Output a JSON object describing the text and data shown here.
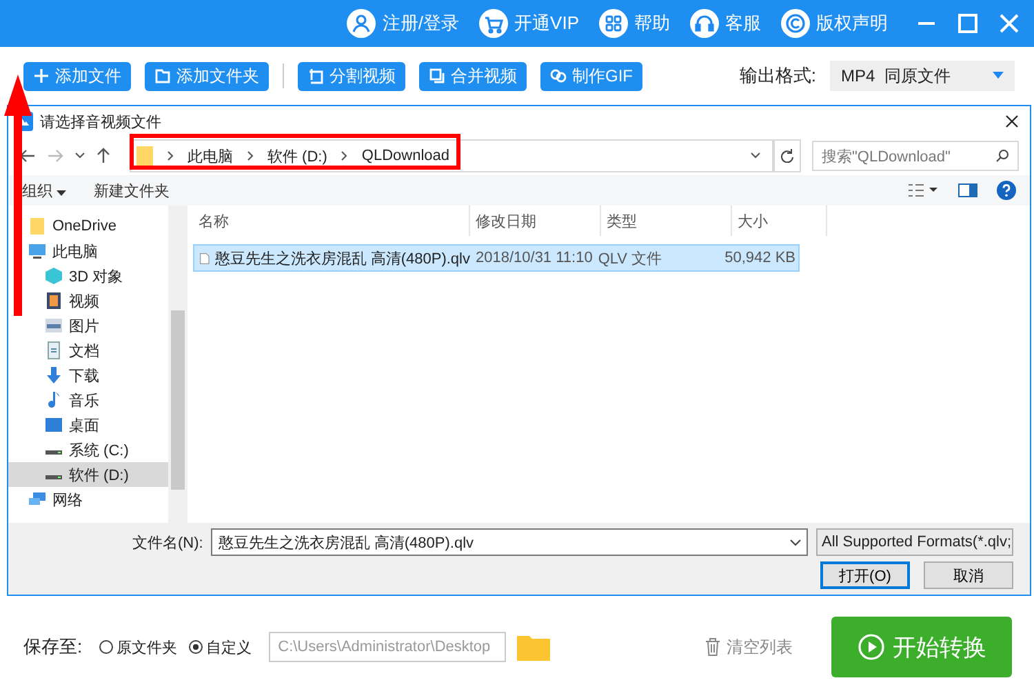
{
  "header": {
    "links": [
      {
        "label": "注册/登录",
        "kind": "user"
      },
      {
        "label": "开通VIP",
        "kind": "cart"
      },
      {
        "label": "帮助",
        "kind": "grid"
      },
      {
        "label": "客服",
        "kind": "headset"
      },
      {
        "label": "版权声明",
        "kind": "copyright"
      }
    ]
  },
  "toolbar": {
    "buttons": [
      {
        "label": "添加文件",
        "kind": "plus"
      },
      {
        "label": "添加文件夹",
        "kind": "folder"
      },
      {
        "label": "分割视频",
        "kind": "split"
      },
      {
        "label": "合并视频",
        "kind": "merge"
      },
      {
        "label": "制作GIF",
        "kind": "gif"
      }
    ],
    "format_label": "输出格式:",
    "format_value": "MP4  同原文件"
  },
  "dialog": {
    "title": "请选择音视频文件",
    "path": [
      "此电脑",
      "软件 (D:)",
      "QLDownload"
    ],
    "search_placeholder": "搜索\"QLDownload\"",
    "organize": "组织",
    "new_folder": "新建文件夹",
    "sidebar": [
      {
        "label": "OneDrive",
        "kind": "folder",
        "selected": false
      },
      {
        "label": "此电脑",
        "kind": "pc",
        "selected": false,
        "children": [
          {
            "label": "3D 对象",
            "kind": "cube",
            "selected": false
          },
          {
            "label": "视频",
            "kind": "video",
            "selected": false
          },
          {
            "label": "图片",
            "kind": "image",
            "selected": false
          },
          {
            "label": "文档",
            "kind": "doc",
            "selected": false
          },
          {
            "label": "下载",
            "kind": "download",
            "selected": false
          },
          {
            "label": "音乐",
            "kind": "music",
            "selected": false
          },
          {
            "label": "桌面",
            "kind": "desktop",
            "selected": false
          },
          {
            "label": "系统 (C:)",
            "kind": "drive",
            "selected": false
          },
          {
            "label": "软件 (D:)",
            "kind": "drive",
            "selected": true
          }
        ]
      },
      {
        "label": "网络",
        "kind": "network",
        "selected": false
      }
    ],
    "columns": [
      "名称",
      "修改日期",
      "类型",
      "大小"
    ],
    "files": [
      {
        "name": "憨豆先生之洗衣房混乱 高清(480P).qlv",
        "date": "2018/10/31 11:10",
        "type": "QLV 文件",
        "size": "50,942 KB",
        "selected": true
      }
    ],
    "filename_label": "文件名(N):",
    "filename": "憨豆先生之洗衣房混乱 高清(480P).qlv",
    "filter": "All Supported Formats(*.qlv;",
    "open": "打开(O)",
    "cancel": "取消"
  },
  "footer": {
    "save_label": "保存至:",
    "options": [
      {
        "label": "原文件夹",
        "selected": false
      },
      {
        "label": "自定义",
        "selected": true
      }
    ],
    "path": "C:\\Users\\Administrator\\Desktop",
    "clear": "清空列表",
    "start": "开始转换"
  }
}
